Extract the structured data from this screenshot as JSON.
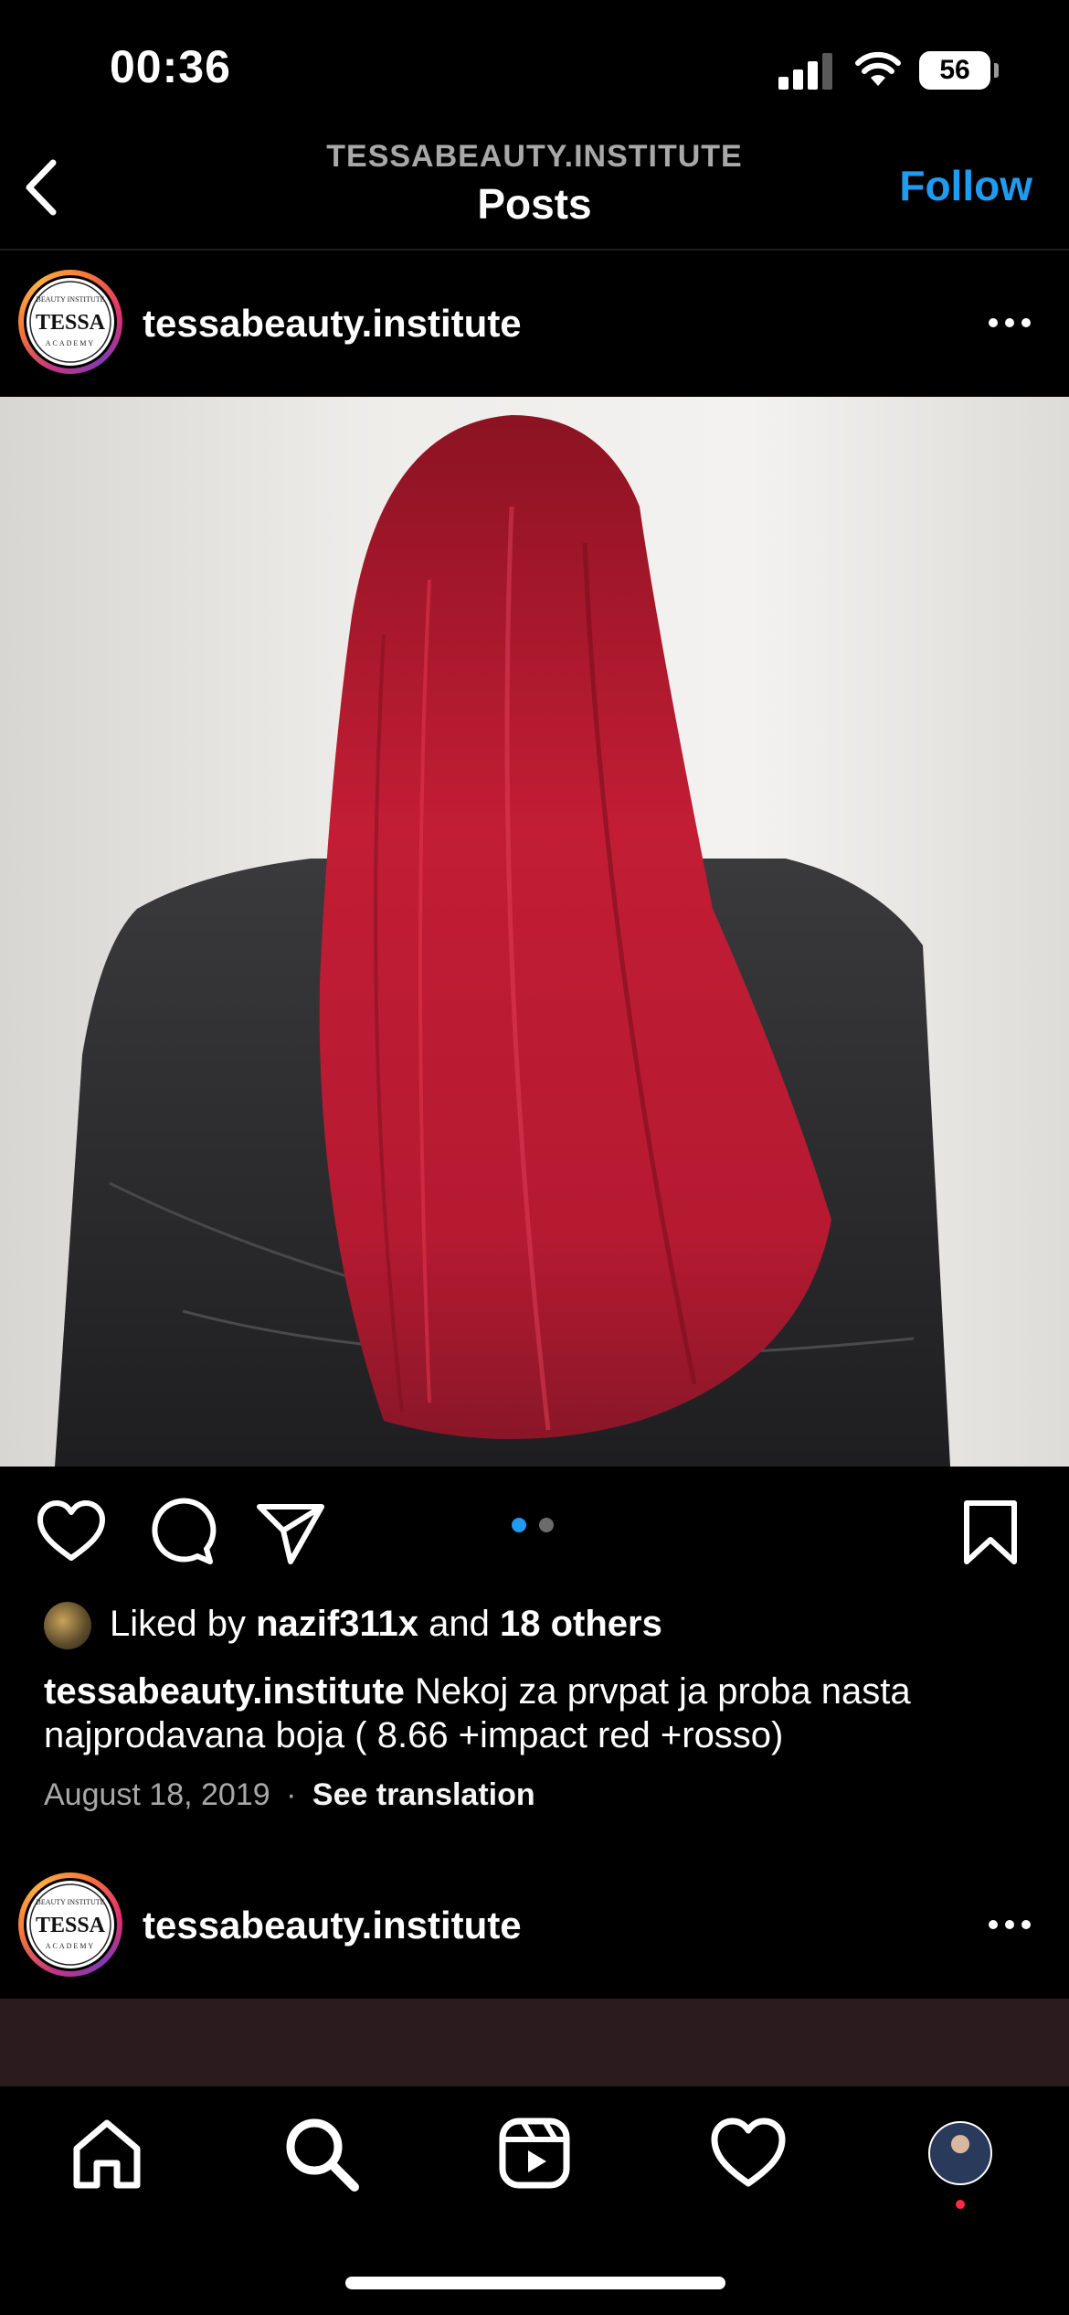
{
  "status_bar": {
    "time": "00:36",
    "battery": "56"
  },
  "header": {
    "subtitle": "TESSABEAUTY.INSTITUTE",
    "title": "Posts",
    "follow_label": "Follow"
  },
  "post": {
    "username": "tessabeauty.institute",
    "avatar_logo": {
      "top": "BEAUTY INSTITUTE",
      "name": "TESSA",
      "bottom": "ACADEMY"
    },
    "carousel": {
      "count": 2,
      "active_index": 0,
      "active_color": "#1f9bf0",
      "inactive_color": "#6b6b6b"
    },
    "likes": {
      "prefix": "Liked by ",
      "user": "nazif311x",
      "middle": " and ",
      "others": "18 others"
    },
    "caption": {
      "username": "tessabeauty.institute",
      "text": " Nekoj za prvpat ja proba nasta najprodavana boja ( 8.66 +impact red +rosso)"
    },
    "date": "August 18, 2019",
    "separator": "·",
    "see_translation": "See translation"
  },
  "next_post": {
    "username": "tessabeauty.institute"
  },
  "tabs": [
    {
      "name": "home",
      "icon": "home-icon"
    },
    {
      "name": "search",
      "icon": "search-icon"
    },
    {
      "name": "reels",
      "icon": "reels-icon"
    },
    {
      "name": "activity",
      "icon": "heart-icon"
    },
    {
      "name": "profile",
      "icon": "profile-avatar",
      "notification_color": "#ff2a44"
    }
  ],
  "colors": {
    "accent": "#1f9bf0",
    "background": "#000000",
    "secondary_text": "#a8a8a8"
  }
}
